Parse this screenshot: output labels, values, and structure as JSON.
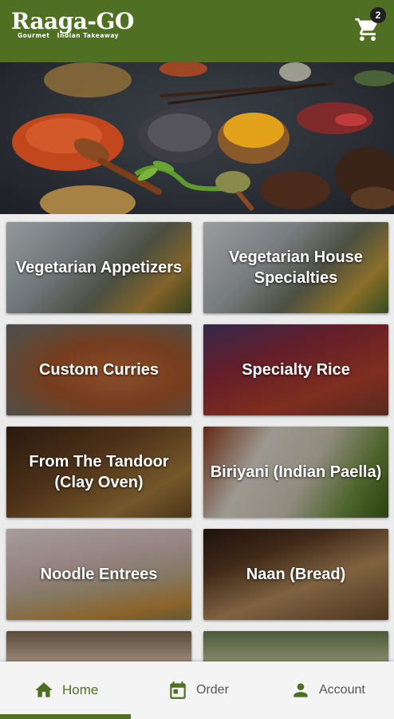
{
  "app": {
    "logo_text": "Raaga-GO",
    "logo_tagline": "Gourmet   Indian Takeaway",
    "cart_count": "2",
    "brand_color": "#4f6f22"
  },
  "categories": [
    {
      "label": "Vegetarian Appetizers"
    },
    {
      "label": "Vegetarian House Specialties"
    },
    {
      "label": "Custom Curries"
    },
    {
      "label": "Specialty Rice"
    },
    {
      "label": "From The Tandoor (Clay Oven)"
    },
    {
      "label": "Biriyani (Indian Paella)"
    },
    {
      "label": "Noodle Entrees"
    },
    {
      "label": "Naan (Bread)"
    }
  ],
  "bottom_nav": {
    "items": [
      {
        "label": "Home",
        "icon": "home-icon",
        "active": true
      },
      {
        "label": "Order",
        "icon": "calendar-icon",
        "active": false
      },
      {
        "label": "Account",
        "icon": "person-icon",
        "active": false
      }
    ]
  }
}
